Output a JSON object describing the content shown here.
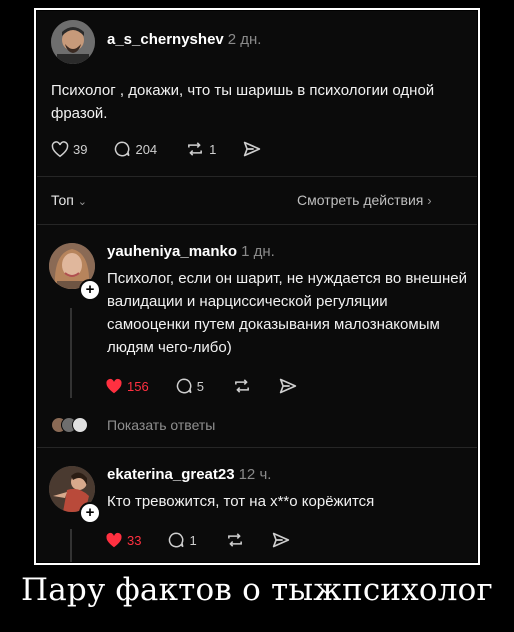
{
  "post": {
    "username": "a_s_chernyshev",
    "time": "2 дн.",
    "text": "Психолог , докажи, что ты шаришь в психологии одной фразой.",
    "likes": "39",
    "comments": "204",
    "reposts": "1"
  },
  "sort": {
    "label": "Топ",
    "view_activity": "Смотреть действия"
  },
  "replies": [
    {
      "username": "yauheniya_manko",
      "time": "1 дн.",
      "text": "Психолог, если он шарит, не нуждается во внешней валидации и нарциссической регуляции самооценки путем доказывания малознакомым людям чего-либо)",
      "likes": "156",
      "comments": "5",
      "show_replies": "Показать ответы"
    },
    {
      "username": "ekaterina_great23",
      "time": "12 ч.",
      "text": "Кто тревожится, тот на х**о корёжится",
      "likes": "33",
      "comments": "1"
    }
  ],
  "caption": "Пару фактов о тыжпсихолог",
  "colors": {
    "like_active": "#ff3040",
    "background": "#0b0b0b"
  }
}
